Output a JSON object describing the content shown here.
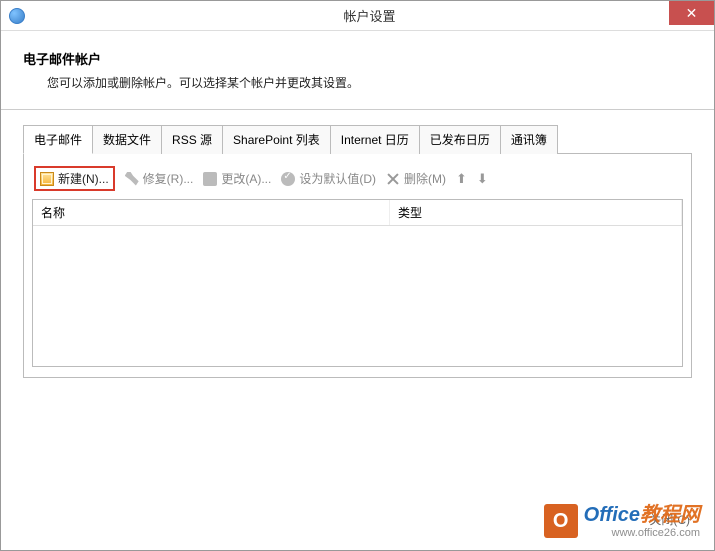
{
  "window": {
    "title": "帐户设置"
  },
  "header": {
    "title": "电子邮件帐户",
    "description": "您可以添加或删除帐户。可以选择某个帐户并更改其设置。"
  },
  "tabs": [
    {
      "label": "电子邮件",
      "active": true
    },
    {
      "label": "数据文件",
      "active": false
    },
    {
      "label": "RSS 源",
      "active": false
    },
    {
      "label": "SharePoint 列表",
      "active": false
    },
    {
      "label": "Internet 日历",
      "active": false
    },
    {
      "label": "已发布日历",
      "active": false
    },
    {
      "label": "通讯簿",
      "active": false
    }
  ],
  "toolbar": {
    "new": "新建(N)...",
    "repair": "修复(R)...",
    "change": "更改(A)...",
    "setdefault": "设为默认值(D)",
    "delete": "删除(M)"
  },
  "table": {
    "col_name": "名称",
    "col_type": "类型",
    "rows": []
  },
  "footer": {
    "close": "关闭(C)"
  },
  "watermark": {
    "brand_main": "Office",
    "brand_suffix": "教程网",
    "url": "www.office26.com"
  }
}
